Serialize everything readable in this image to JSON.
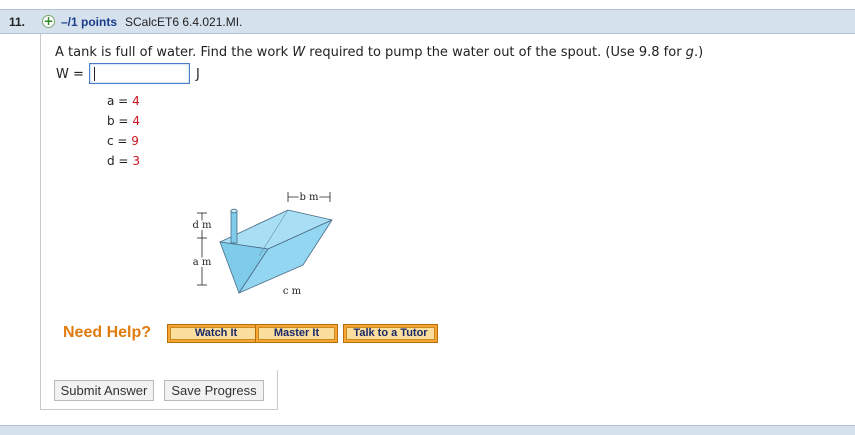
{
  "header": {
    "number": "11.",
    "points": "–/1 points",
    "course_code": "SCalcET6 6.4.021.MI."
  },
  "question": {
    "prompt_pre": "A tank is full of water. Find the work ",
    "prompt_var": "W",
    "prompt_mid": " required to pump the water out of the spout. (Use 9.8 for ",
    "prompt_g": "g",
    "prompt_post": ".)",
    "answer_label": "W =",
    "answer_value": "",
    "answer_unit": "J"
  },
  "variables": [
    {
      "label": "a =",
      "value": "4"
    },
    {
      "label": "b =",
      "value": "4"
    },
    {
      "label": "c =",
      "value": "9"
    },
    {
      "label": "d =",
      "value": "3"
    }
  ],
  "diagram": {
    "b_label": "b m",
    "d_label": "d m",
    "a_label": "a m",
    "c_label": "c m"
  },
  "help": {
    "title": "Need Help?",
    "watch": "Watch It",
    "master": "Master It",
    "tutor": "Talk to a Tutor"
  },
  "actions": {
    "submit": "Submit Answer",
    "save": "Save Progress"
  },
  "colors": {
    "header_bg": "#d6e1ee",
    "value_red": "#c8141b",
    "help_orange": "#e07b10",
    "water_blue": "#8fd3f0"
  }
}
